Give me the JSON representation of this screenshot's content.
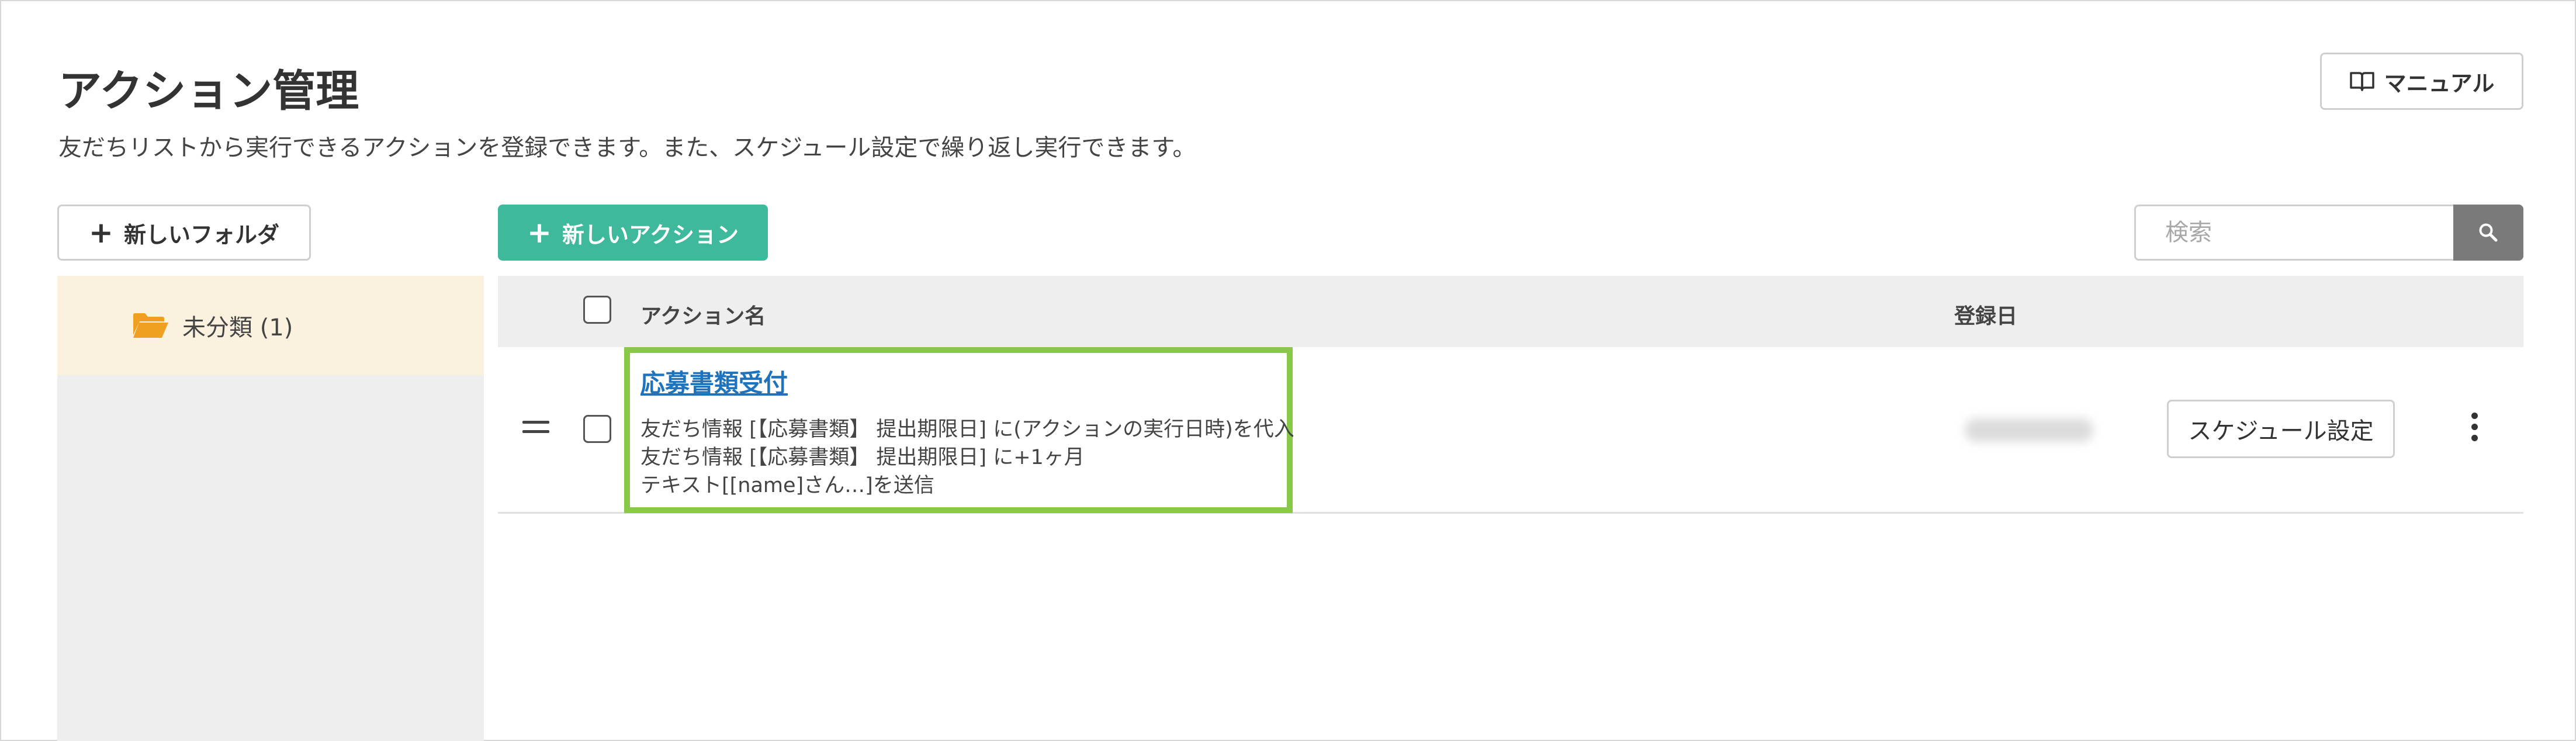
{
  "header": {
    "title": "アクション管理",
    "subtitle": "友だちリストから実行できるアクションを登録できます。また、スケジュール設定で繰り返し実行できます。",
    "manual_label": "マニュアル"
  },
  "toolbar": {
    "new_folder_label": "新しいフォルダ",
    "new_action_label": "新しいアクション",
    "search_placeholder": "検索"
  },
  "sidebar": {
    "folders": [
      {
        "label": "未分類 (1)"
      }
    ]
  },
  "table": {
    "columns": [
      "アクション名",
      "登録日"
    ],
    "rows": [
      {
        "name": "応募書類受付",
        "details": [
          "友だち情報 [【応募書類】 提出期限日] に(アクションの実行日時)を代入",
          "友だち情報 [【応募書類】 提出期限日] に+1ヶ月",
          "テキスト[[name]さん…]を送信"
        ],
        "schedule_label": "スケジュール設定"
      }
    ]
  },
  "colors": {
    "accent": "#3fb99b",
    "highlight_border": "#8ac947",
    "link": "#1e73be",
    "folder_selected_bg": "#fbf1df",
    "folder_icon": "#f0a020"
  },
  "icons": {
    "manual": "book-icon",
    "search": "search-icon",
    "folder": "folder-open-icon",
    "drag": "drag-handle-icon",
    "more": "more-vertical-icon"
  }
}
